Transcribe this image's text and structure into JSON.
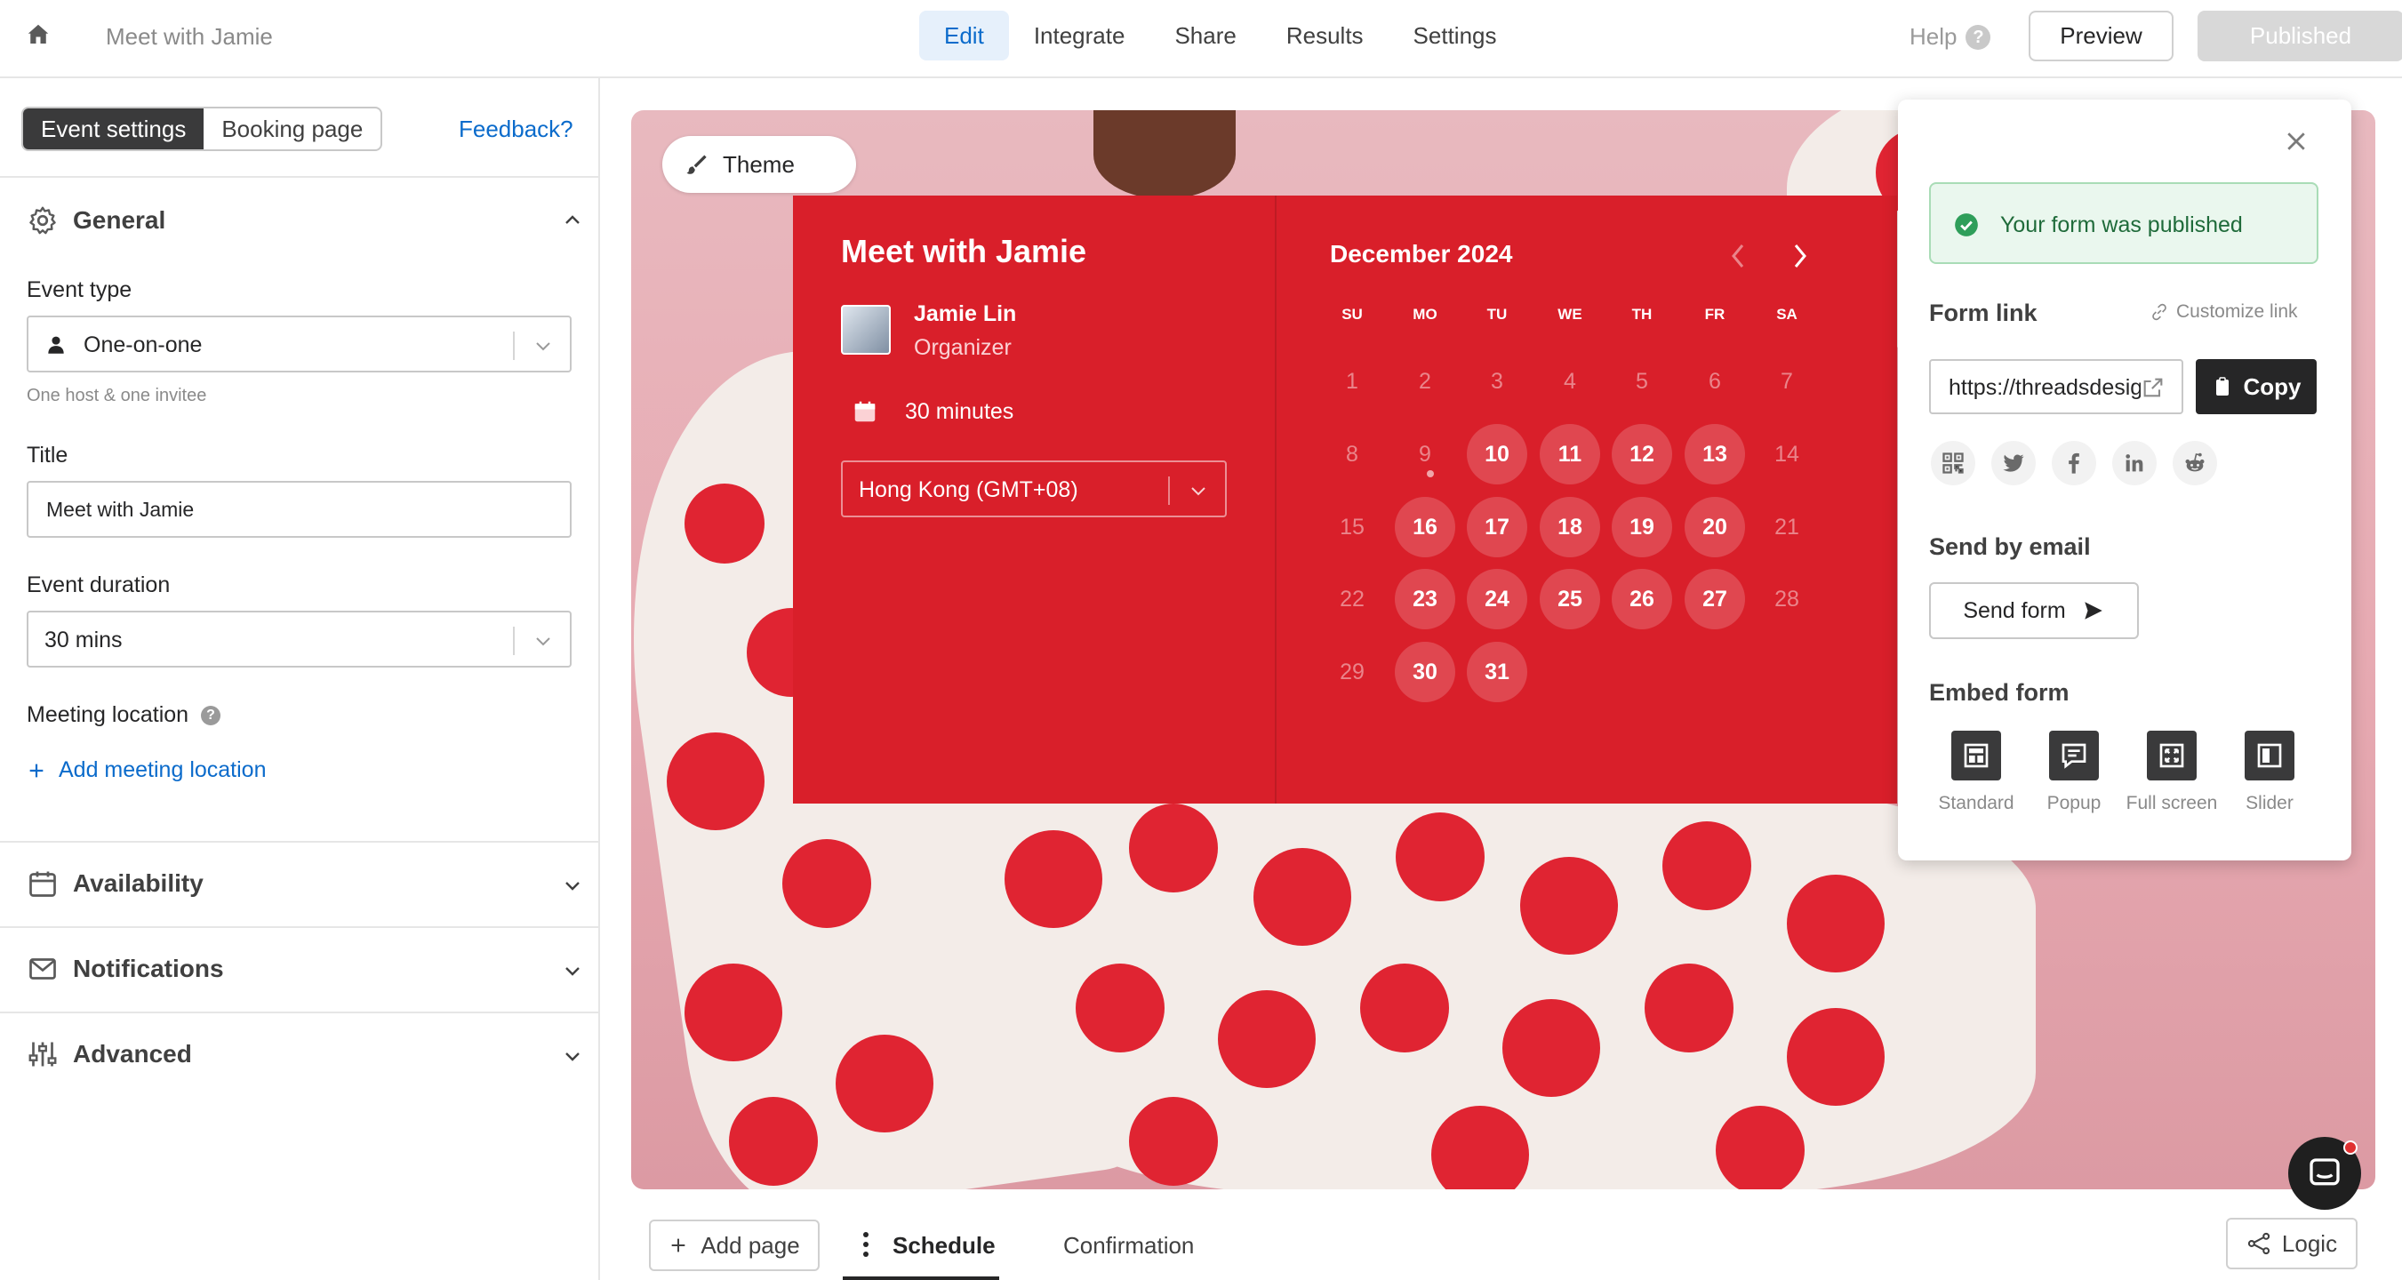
{
  "topbar": {
    "form_title": "Meet with Jamie",
    "nav": [
      "Edit",
      "Integrate",
      "Share",
      "Results",
      "Settings"
    ],
    "help": "Help",
    "preview": "Preview",
    "published": "Published"
  },
  "left": {
    "tabs": [
      "Event settings",
      "Booking page"
    ],
    "feedback": "Feedback?",
    "general": {
      "heading": "General",
      "event_type_label": "Event type",
      "event_type_value": "One-on-one",
      "event_type_hint": "One host & one invitee",
      "title_label": "Title",
      "title_value": "Meet with Jamie",
      "duration_label": "Event duration",
      "duration_value": "30 mins",
      "location_label": "Meeting location",
      "add_location": "Add meeting location"
    },
    "sections": [
      "Availability",
      "Notifications",
      "Advanced"
    ]
  },
  "canvas": {
    "theme_button": "Theme",
    "card": {
      "title": "Meet with Jamie",
      "host_name": "Jamie Lin",
      "host_role": "Organizer",
      "duration": "30 minutes",
      "timezone": "Hong Kong (GMT+08)",
      "month": "December 2024",
      "weekdays": [
        "SU",
        "MO",
        "TU",
        "WE",
        "TH",
        "FR",
        "SA"
      ],
      "weeks": [
        [
          "1",
          "2",
          "3",
          "4",
          "5",
          "6",
          "7"
        ],
        [
          "8",
          "9",
          "10",
          "11",
          "12",
          "13",
          "14"
        ],
        [
          "15",
          "16",
          "17",
          "18",
          "19",
          "20",
          "21"
        ],
        [
          "22",
          "23",
          "24",
          "25",
          "26",
          "27",
          "28"
        ],
        [
          "29",
          "30",
          "31",
          "",
          "",
          "",
          ""
        ]
      ],
      "available_days": [
        "10",
        "11",
        "12",
        "13",
        "16",
        "17",
        "18",
        "19",
        "20",
        "23",
        "24",
        "25",
        "26",
        "27",
        "30",
        "31"
      ],
      "accent_color": "#d91f2a"
    }
  },
  "share_popup": {
    "published_message": "Your form was published",
    "form_link_label": "Form link",
    "customize_link": "Customize link",
    "link_value": "https://threadsdesign",
    "copy": "Copy",
    "socials": [
      "qr-code-icon",
      "twitter-icon",
      "facebook-icon",
      "linkedin-icon",
      "reddit-icon"
    ],
    "send_by_email_label": "Send by email",
    "send_form": "Send form",
    "embed_label": "Embed form",
    "embed_options": [
      "Standard",
      "Popup",
      "Full screen",
      "Slider"
    ]
  },
  "bottom": {
    "add_page": "Add page",
    "tabs": [
      "Schedule",
      "Confirmation"
    ],
    "logic": "Logic"
  }
}
